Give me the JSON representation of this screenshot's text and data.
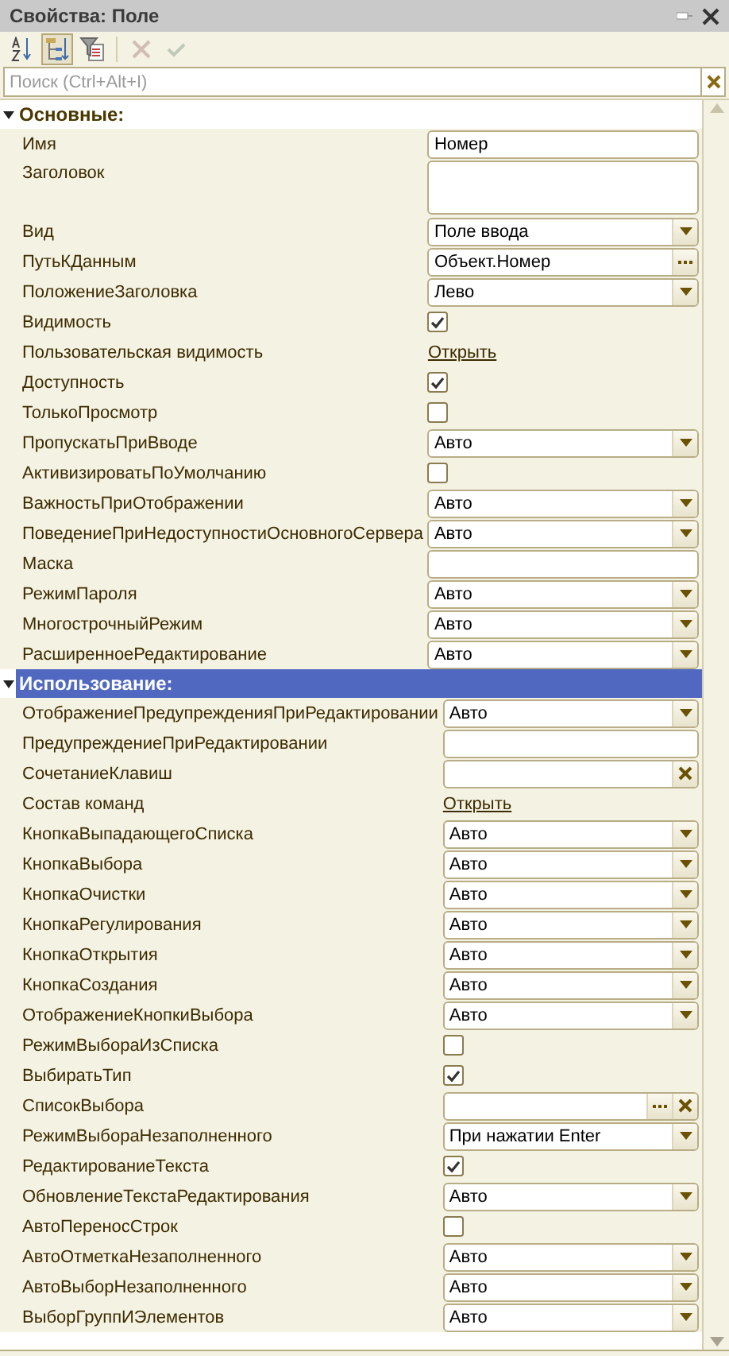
{
  "window": {
    "title": "Свойства: Поле"
  },
  "toolbar": [
    {
      "kind": "sort",
      "pressed": false,
      "disabled": false
    },
    {
      "kind": "categories",
      "pressed": true,
      "disabled": false
    },
    {
      "kind": "filter",
      "pressed": false,
      "disabled": false
    },
    {
      "kind": "delete",
      "pressed": false,
      "disabled": true
    },
    {
      "kind": "apply",
      "pressed": false,
      "disabled": true
    }
  ],
  "search": {
    "placeholder": "Поиск (Ctrl+Alt+I)"
  },
  "sections": [
    {
      "title": "Основные:",
      "expanded": true,
      "selected": false,
      "rows": [
        {
          "label": "Имя",
          "kind": "text",
          "value": "Номер"
        },
        {
          "label": "Заголовок",
          "kind": "textarea"
        },
        {
          "label": "Вид",
          "kind": "select",
          "value": "Поле ввода"
        },
        {
          "label": "ПутьКДанным",
          "kind": "pick",
          "value": "Объект.Номер"
        },
        {
          "label": "ПоложениеЗаголовка",
          "kind": "select",
          "value": "Лево"
        },
        {
          "label": "Видимость",
          "kind": "check",
          "checked": true
        },
        {
          "label": "Пользовательская видимость",
          "kind": "link",
          "value": "Открыть"
        },
        {
          "label": "Доступность",
          "kind": "check",
          "checked": true
        },
        {
          "label": "ТолькоПросмотр",
          "kind": "check",
          "checked": false
        },
        {
          "label": "ПропускатьПриВводе",
          "kind": "select",
          "value": "Авто"
        },
        {
          "label": "АктивизироватьПоУмолчанию",
          "kind": "check",
          "checked": false
        },
        {
          "label": "ВажностьПриОтображении",
          "kind": "select",
          "value": "Авто"
        },
        {
          "label": "ПоведениеПриНедоступностиОсновногоСервера",
          "kind": "select",
          "value": "Авто"
        },
        {
          "label": "Маска",
          "kind": "text"
        },
        {
          "label": "РежимПароля",
          "kind": "select",
          "value": "Авто"
        },
        {
          "label": "МногострочныйРежим",
          "kind": "select",
          "value": "Авто"
        },
        {
          "label": "РасширенноеРедактирование",
          "kind": "select",
          "value": "Авто"
        }
      ]
    },
    {
      "title": "Использование:",
      "expanded": true,
      "selected": true,
      "rows": [
        {
          "label": "ОтображениеПредупрежденияПриРедактировании",
          "kind": "select",
          "value": "Авто"
        },
        {
          "label": "ПредупреждениеПриРедактировании",
          "kind": "text"
        },
        {
          "label": "СочетаниеКлавиш",
          "kind": "clear"
        },
        {
          "label": "Состав команд",
          "kind": "link",
          "value": "Открыть"
        },
        {
          "label": "КнопкаВыпадающегоСписка",
          "kind": "select",
          "value": "Авто"
        },
        {
          "label": "КнопкаВыбора",
          "kind": "select",
          "value": "Авто"
        },
        {
          "label": "КнопкаОчистки",
          "kind": "select",
          "value": "Авто"
        },
        {
          "label": "КнопкаРегулирования",
          "kind": "select",
          "value": "Авто"
        },
        {
          "label": "КнопкаОткрытия",
          "kind": "select",
          "value": "Авто"
        },
        {
          "label": "КнопкаСоздания",
          "kind": "select",
          "value": "Авто"
        },
        {
          "label": "ОтображениеКнопкиВыбора",
          "kind": "select",
          "value": "Авто"
        },
        {
          "label": "РежимВыбораИзСписка",
          "kind": "check",
          "checked": false
        },
        {
          "label": "ВыбиратьТип",
          "kind": "check",
          "checked": true
        },
        {
          "label": "СписокВыбора",
          "kind": "pickclear"
        },
        {
          "label": "РежимВыбораНезаполненного",
          "kind": "select",
          "value": "При нажатии Enter"
        },
        {
          "label": "РедактированиеТекста",
          "kind": "check",
          "checked": true
        },
        {
          "label": "ОбновлениеТекстаРедактирования",
          "kind": "select",
          "value": "Авто"
        },
        {
          "label": "АвтоПереносСтрок",
          "kind": "check",
          "checked": false
        },
        {
          "label": "АвтоОтметкаНезаполненного",
          "kind": "select",
          "value": "Авто"
        },
        {
          "label": "АвтоВыборНезаполненного",
          "kind": "select",
          "value": "Авто"
        },
        {
          "label": "ВыборГруппИЭлементов",
          "kind": "select",
          "value": "Авто"
        }
      ]
    }
  ]
}
